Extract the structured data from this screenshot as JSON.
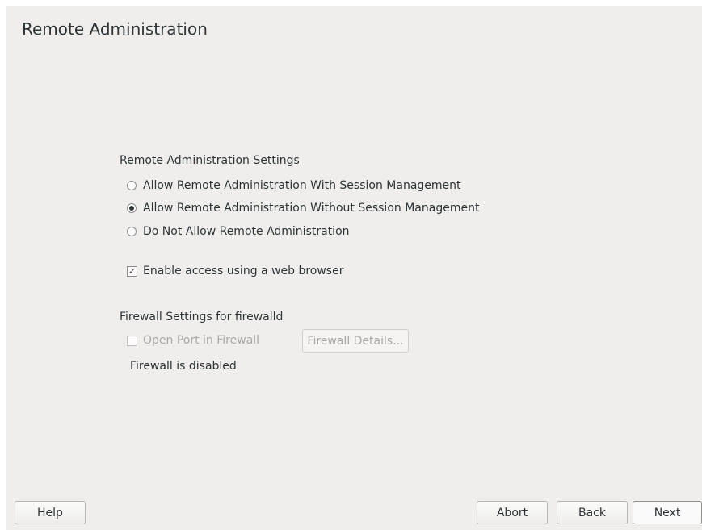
{
  "page": {
    "title": "Remote Administration"
  },
  "remote_admin": {
    "section_label": "Remote Administration Settings",
    "options": [
      {
        "label": "Allow Remote Administration With Session Management",
        "selected": false
      },
      {
        "label": "Allow Remote Administration Without Session Management",
        "selected": true
      },
      {
        "label": "Do Not Allow Remote Administration",
        "selected": false
      }
    ],
    "web_browser": {
      "label": "Enable access using a web browser",
      "checked": true
    }
  },
  "firewall": {
    "section_label": "Firewall Settings for firewalld",
    "open_port": {
      "label": "Open Port in Firewall",
      "checked": false,
      "enabled": false
    },
    "details_button": "Firewall Details...",
    "status": "Firewall is disabled"
  },
  "footer": {
    "help": "Help",
    "abort": "Abort",
    "back": "Back",
    "next": "Next"
  },
  "icons": {
    "checkmark": "check-icon",
    "radio_dot": "radio-selected-icon"
  },
  "colors": {
    "background": "#efeeec",
    "text": "#2e3436",
    "disabled_text": "#a8a8a8"
  }
}
